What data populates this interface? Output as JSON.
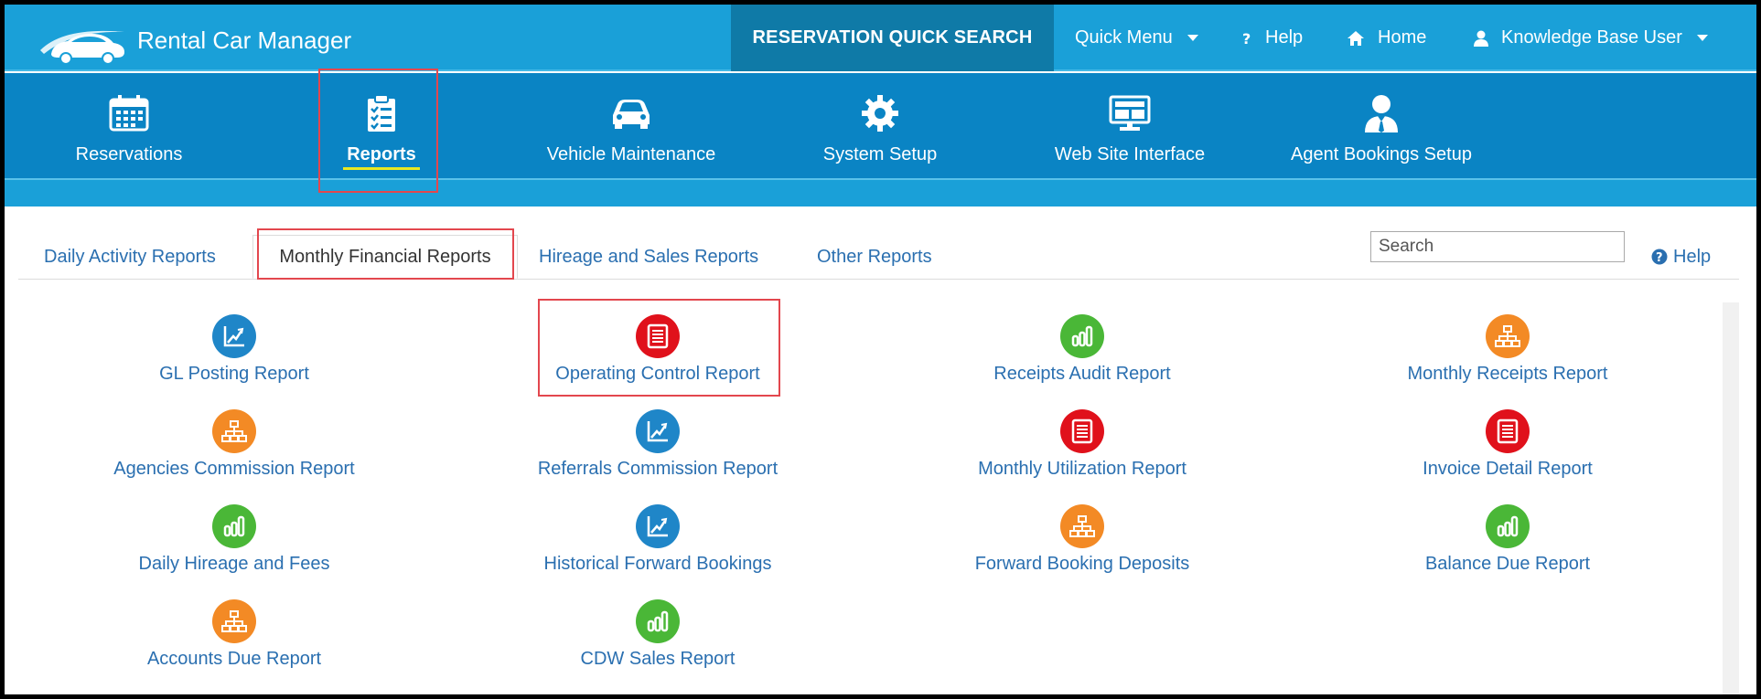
{
  "app": {
    "title": "Rental Car Manager"
  },
  "topbar": {
    "quick_search": "RESERVATION QUICK SEARCH",
    "quick_menu": "Quick Menu",
    "help": "Help",
    "home": "Home",
    "user": "Knowledge Base User"
  },
  "nav": {
    "items": [
      {
        "label": "Reservations",
        "icon": "calendar-icon"
      },
      {
        "label": "Reports",
        "icon": "clipboard-icon"
      },
      {
        "label": "Vehicle Maintenance",
        "icon": "car-icon"
      },
      {
        "label": "System Setup",
        "icon": "gear-icon"
      },
      {
        "label": "Web Site Interface",
        "icon": "monitor-icon"
      },
      {
        "label": "Agent Bookings Setup",
        "icon": "agent-icon"
      }
    ],
    "active": "Reports"
  },
  "tabs": {
    "items": [
      {
        "label": "Daily Activity Reports"
      },
      {
        "label": "Monthly Financial Reports"
      },
      {
        "label": "Hireage and Sales Reports"
      },
      {
        "label": "Other Reports"
      }
    ],
    "active": "Monthly Financial Reports",
    "search_placeholder": "Search",
    "help": "Help"
  },
  "reports": [
    {
      "label": "GL Posting Report",
      "icon": "chart-icon",
      "color": "#1f86c8"
    },
    {
      "label": "Operating Control Report",
      "icon": "document-icon",
      "color": "#e0111b"
    },
    {
      "label": "Receipts Audit Report",
      "icon": "bars-icon",
      "color": "#4ab737"
    },
    {
      "label": "Monthly Receipts Report",
      "icon": "hierarchy-icon",
      "color": "#f38a25"
    },
    {
      "label": "Agencies Commission Report",
      "icon": "hierarchy-icon",
      "color": "#f38a25"
    },
    {
      "label": "Referrals Commission Report",
      "icon": "chart-icon",
      "color": "#1f86c8"
    },
    {
      "label": "Monthly Utilization Report",
      "icon": "document-icon",
      "color": "#e0111b"
    },
    {
      "label": "Invoice Detail Report",
      "icon": "document-icon",
      "color": "#e0111b"
    },
    {
      "label": "Daily Hireage and Fees",
      "icon": "bars-icon",
      "color": "#4ab737"
    },
    {
      "label": "Historical Forward Bookings",
      "icon": "chart-icon",
      "color": "#1f86c8"
    },
    {
      "label": "Forward Booking Deposits",
      "icon": "hierarchy-icon",
      "color": "#f38a25"
    },
    {
      "label": "Balance Due Report",
      "icon": "bars-icon",
      "color": "#4ab737"
    },
    {
      "label": "Accounts Due Report",
      "icon": "hierarchy-icon",
      "color": "#f38a25"
    },
    {
      "label": "CDW Sales Report",
      "icon": "bars-icon",
      "color": "#4ab737"
    }
  ]
}
